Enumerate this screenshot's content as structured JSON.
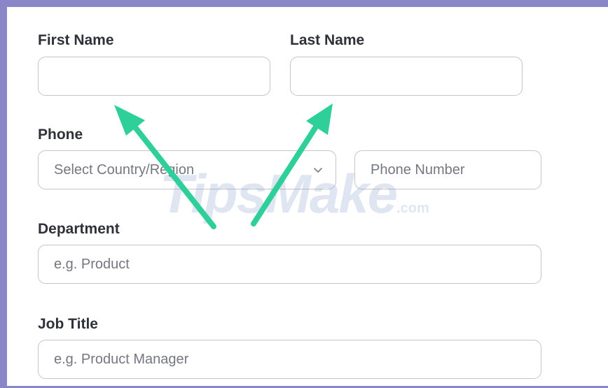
{
  "form": {
    "first_name": {
      "label": "First Name",
      "value": ""
    },
    "last_name": {
      "label": "Last Name",
      "value": ""
    },
    "phone": {
      "label": "Phone",
      "country_placeholder": "Select Country/Region",
      "number_placeholder": "Phone Number"
    },
    "department": {
      "label": "Department",
      "placeholder": "e.g. Product"
    },
    "job_title": {
      "label": "Job Title",
      "placeholder": "e.g. Product Manager"
    }
  },
  "watermark": {
    "main": "TipsMake",
    "suffix": ".com"
  },
  "colors": {
    "frame": "#8b86c7",
    "arrow": "#2fcf9a",
    "border": "#c4c5ca"
  },
  "icons": {
    "country_select": "chevron-down-icon",
    "arrows": "arrow-up-icon"
  }
}
